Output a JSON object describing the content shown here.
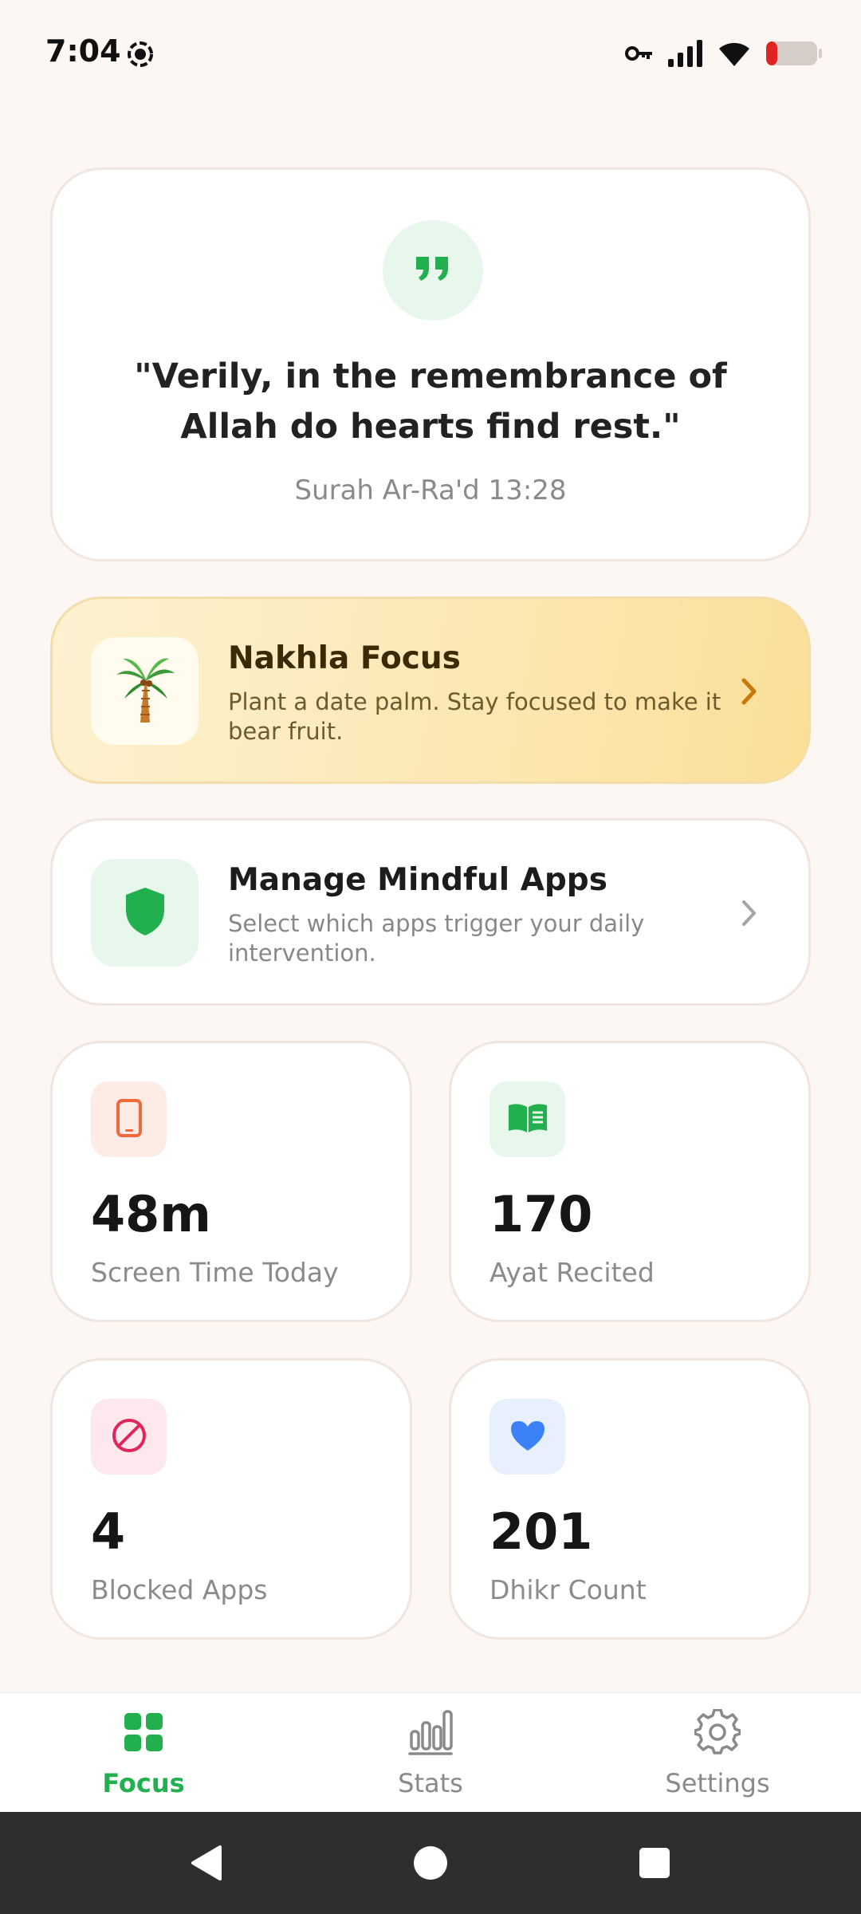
{
  "status_bar": {
    "time": "7:04",
    "icons": [
      "screen-record-icon",
      "vpn-key-icon",
      "signal-icon",
      "wifi-icon",
      "battery-low-icon"
    ]
  },
  "quote": {
    "icon": "quote-icon",
    "text": "\"Verily, in the remembrance of Allah do hearts find rest.\"",
    "source": "Surah Ar-Ra'd 13:28"
  },
  "focus_card": {
    "icon": "palm-tree-icon",
    "title": "Nakhla Focus",
    "subtitle": "Plant a date palm. Stay focused to make it bear fruit."
  },
  "apps_card": {
    "icon": "shield-icon",
    "title": "Manage Mindful Apps",
    "subtitle": "Select which apps trigger your daily intervention."
  },
  "stats": [
    {
      "icon": "phone-icon",
      "value": "48m",
      "label": "Screen Time Today"
    },
    {
      "icon": "book-icon",
      "value": "170",
      "label": "Ayat Recited"
    },
    {
      "icon": "blocked-icon",
      "value": "4",
      "label": "Blocked Apps"
    },
    {
      "icon": "heart-icon",
      "value": "201",
      "label": "Dhikr Count"
    }
  ],
  "bottom_nav": {
    "items": [
      {
        "label": "Focus",
        "icon": "grid-icon",
        "active": true
      },
      {
        "label": "Stats",
        "icon": "bar-chart-icon",
        "active": false
      },
      {
        "label": "Settings",
        "icon": "gear-icon",
        "active": false
      }
    ]
  },
  "colors": {
    "accent": "#22b04f",
    "background": "#fcf7f3",
    "focus_gradient_end": "#fbdf98",
    "phone_icon": "#f06a3c",
    "blocked_icon": "#e0245e",
    "heart_icon": "#3b82f6"
  }
}
